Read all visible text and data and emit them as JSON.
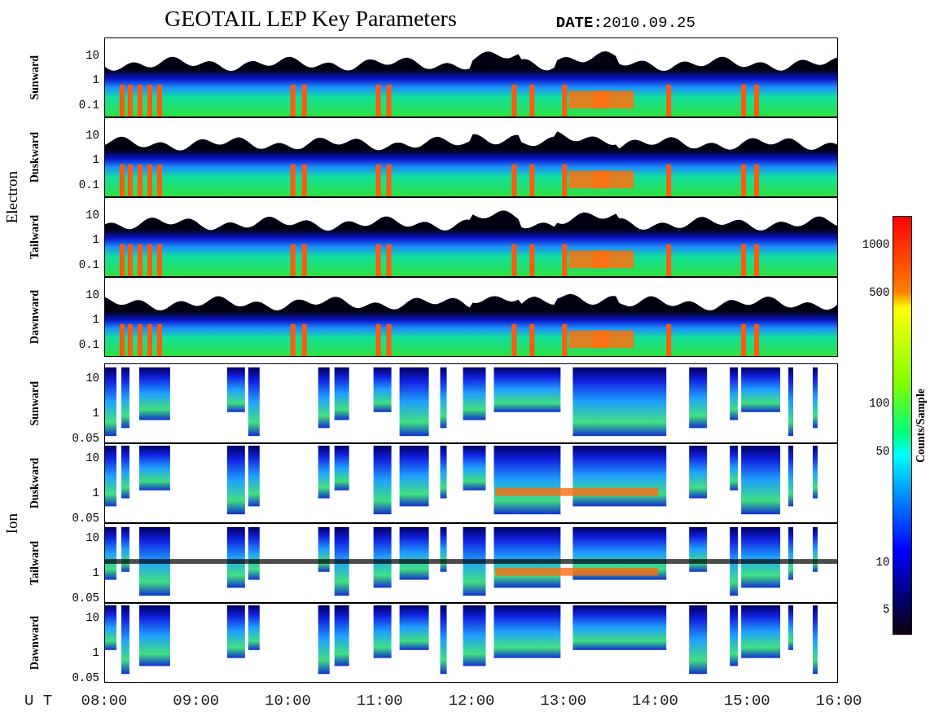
{
  "title": "GEOTAIL LEP Key Parameters",
  "date": "**DATE:**2010.09.25",
  "groups": [
    {
      "kind": "electron",
      "name": "Electron",
      "panels": [
        {
          "direction": "Sunward",
          "yticks": [
            "10",
            "1",
            "0.1"
          ]
        },
        {
          "direction": "Duskward",
          "yticks": [
            "10",
            "1",
            "0.1"
          ]
        },
        {
          "direction": "Tailward",
          "yticks": [
            "10",
            "1",
            "0.1"
          ]
        },
        {
          "direction": "Dawnward",
          "yticks": [
            "10",
            "1",
            "0.1"
          ]
        }
      ]
    },
    {
      "kind": "ion",
      "name": "Ion",
      "panels": [
        {
          "direction": "Sunward",
          "yticks": [
            "10",
            "1",
            "0.05"
          ]
        },
        {
          "direction": "Duskward",
          "yticks": [
            "10",
            "1",
            "0.05"
          ]
        },
        {
          "direction": "Tailward",
          "yticks": [
            "10",
            "1",
            "0.05"
          ]
        },
        {
          "direction": "Dawnward",
          "yticks": [
            "10",
            "1",
            "0.05"
          ]
        }
      ]
    }
  ],
  "colorbar": {
    "label": "Counts/Sample",
    "ticks": [
      "1000",
      "500",
      "100",
      "50",
      "10",
      "5"
    ]
  },
  "xaxis": {
    "label": "U T",
    "ticks": [
      "08:00",
      "09:00",
      "10:00",
      "11:00",
      "12:00",
      "13:00",
      "14:00",
      "15:00",
      "16:00"
    ]
  }
}
